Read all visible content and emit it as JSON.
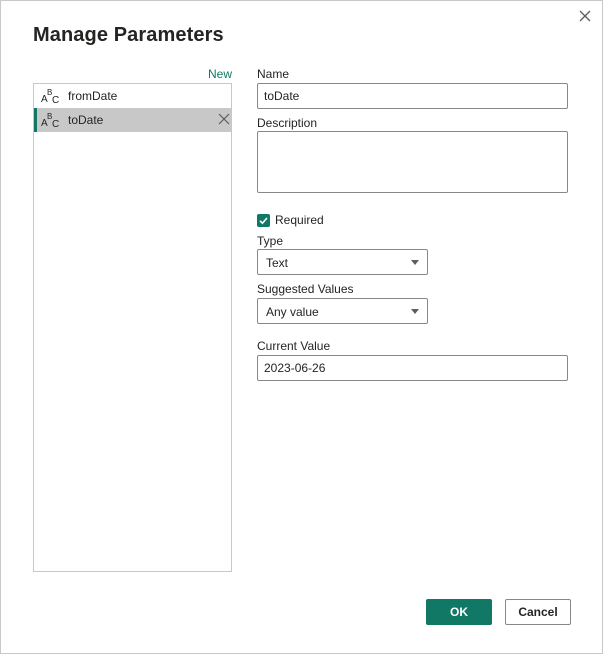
{
  "dialog": {
    "title": "Manage Parameters",
    "close_icon": "close-icon"
  },
  "list": {
    "new_label": "New",
    "items": [
      {
        "label": "fromDate",
        "icon": "abc-text-type-icon",
        "selected": false
      },
      {
        "label": "toDate",
        "icon": "abc-text-type-icon",
        "selected": true
      }
    ]
  },
  "form": {
    "name_label": "Name",
    "name_value": "toDate",
    "description_label": "Description",
    "description_value": "",
    "required_label": "Required",
    "required_checked": true,
    "type_label": "Type",
    "type_value": "Text",
    "suggested_label": "Suggested Values",
    "suggested_value": "Any value",
    "current_label": "Current Value",
    "current_value": "2023-06-26"
  },
  "footer": {
    "ok_label": "OK",
    "cancel_label": "Cancel"
  },
  "colors": {
    "accent": "#117865",
    "selected_bg": "#c8c8c8",
    "border": "#8a8886"
  }
}
